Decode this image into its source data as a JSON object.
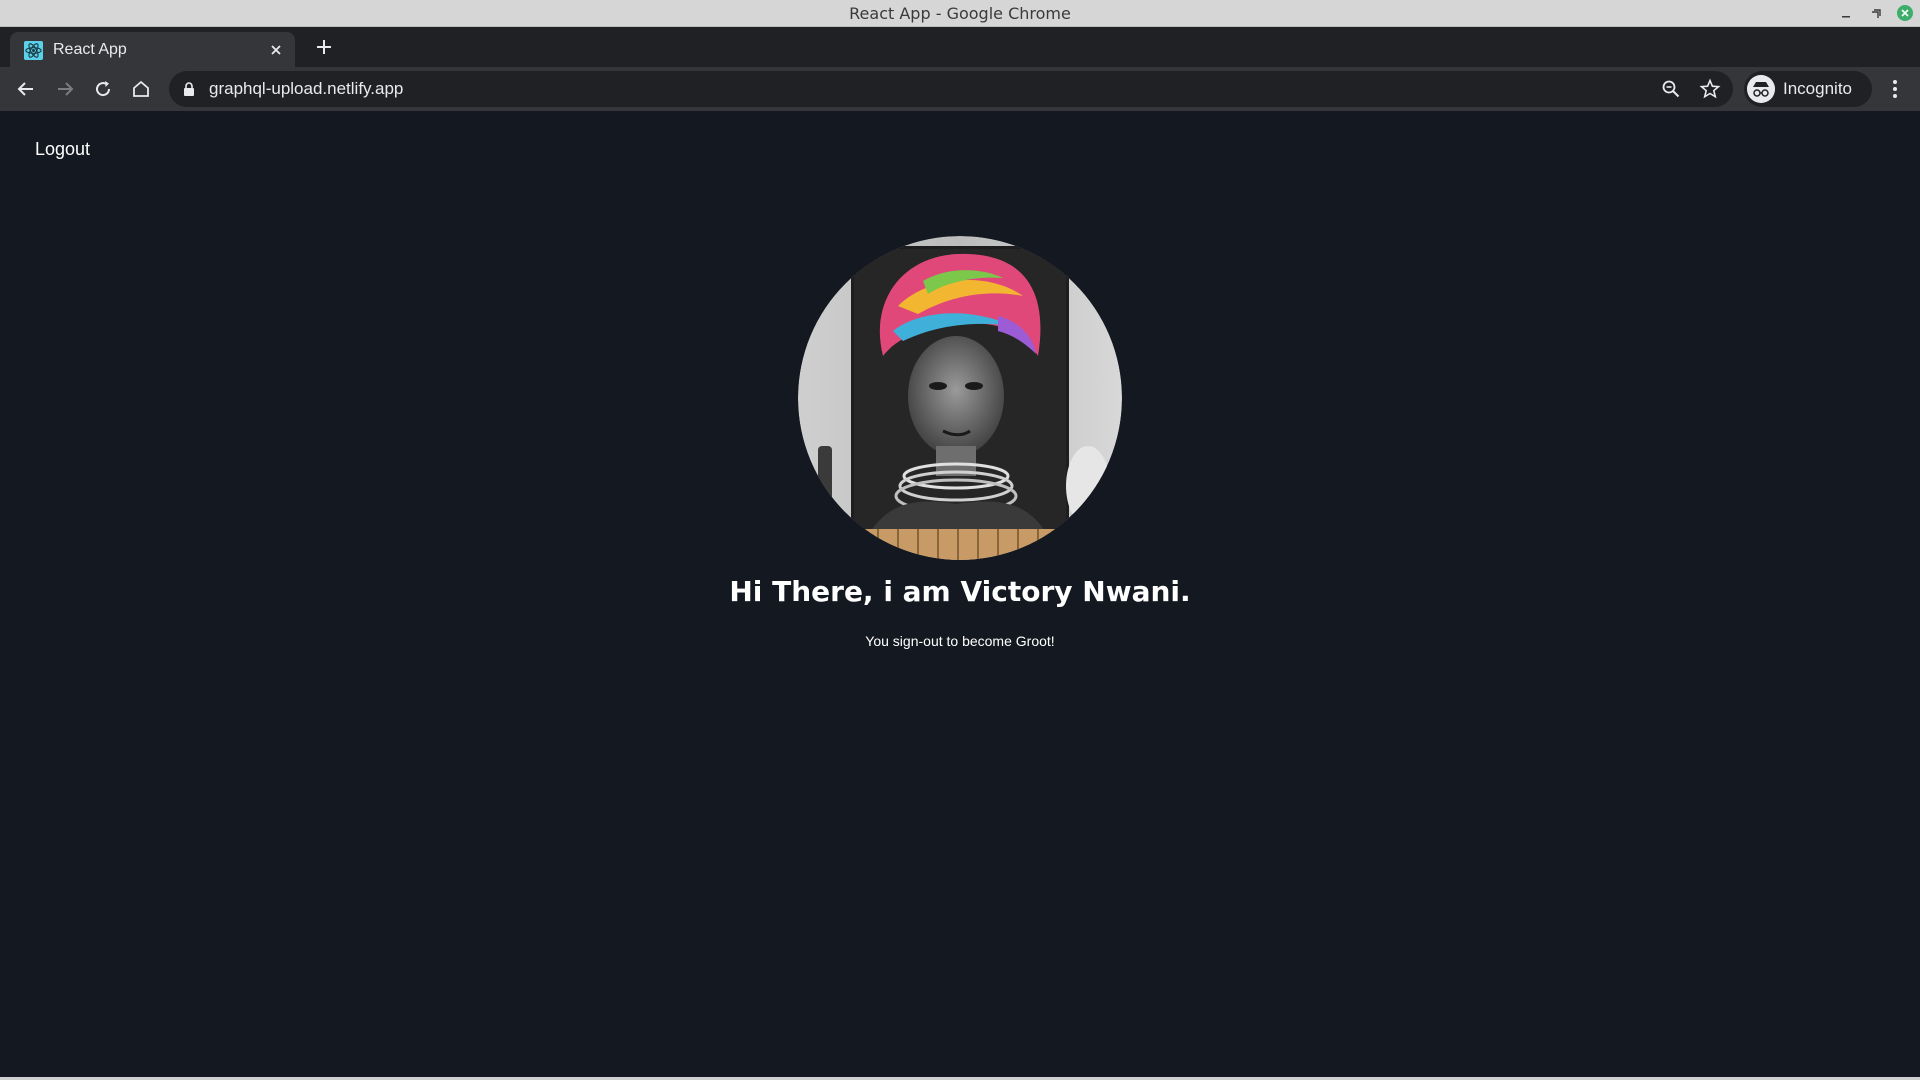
{
  "window": {
    "title": "React App - Google Chrome"
  },
  "tabs": [
    {
      "title": "React App",
      "favicon": "react-logo-icon",
      "active": true
    }
  ],
  "toolbar": {
    "url": "graphql-upload.netlify.app",
    "profile_label": "Incognito"
  },
  "page": {
    "logout_label": "Logout",
    "greeting": "Hi There, i am Victory Nwani.",
    "subtext": "You sign-out to become Groot!"
  },
  "colors": {
    "page_background": "#141821",
    "tab_strip": "#202124",
    "toolbar": "#35363a",
    "text_primary": "#ffffff"
  }
}
